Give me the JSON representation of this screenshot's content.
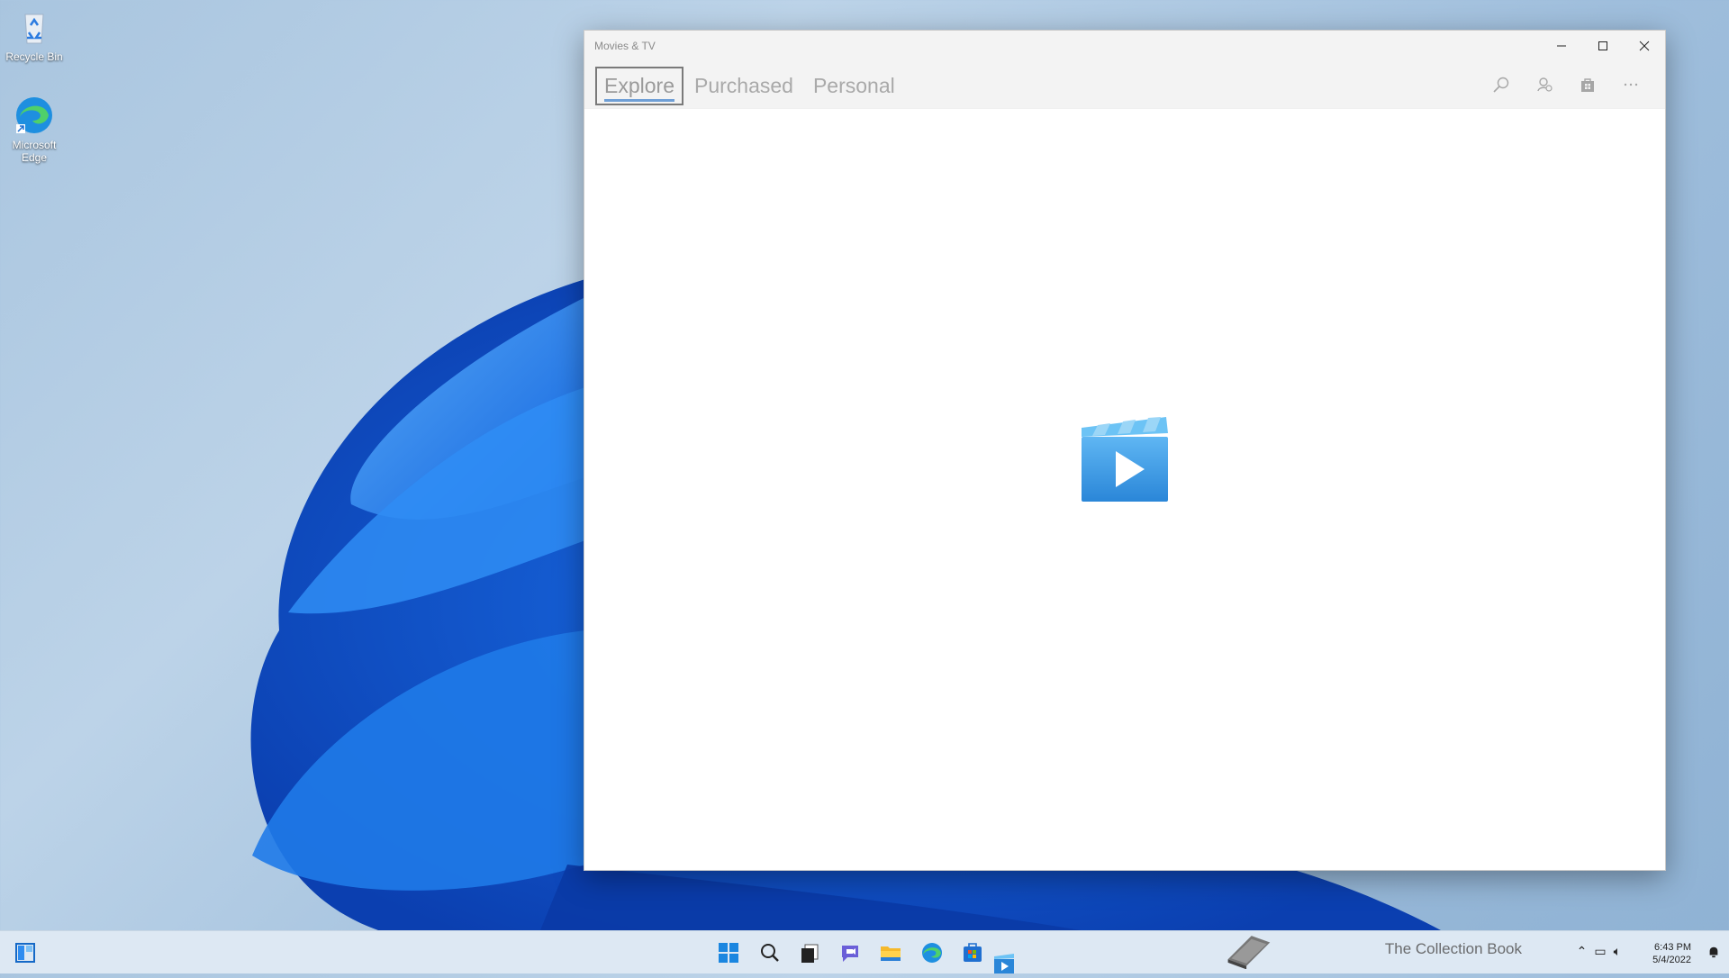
{
  "desktop": {
    "icons": [
      {
        "label": "Recycle Bin"
      },
      {
        "label": "Microsoft Edge"
      }
    ]
  },
  "window": {
    "title": "Movies & TV",
    "caption": {
      "minimize": "minimize-icon",
      "maximize": "maximize-icon",
      "close": "close-icon"
    },
    "tabs": [
      {
        "label": "Explore",
        "selected": true
      },
      {
        "label": "Purchased",
        "selected": false
      },
      {
        "label": "Personal",
        "selected": false
      }
    ],
    "tools": [
      "search-icon",
      "account-icon",
      "store-bag-icon",
      "more-icon"
    ],
    "accent": "#3a8ee6"
  },
  "taskbar": {
    "items": [
      "widgets-icon",
      "start-icon",
      "search-icon",
      "task-view-icon",
      "chat-icon",
      "file-explorer-icon",
      "edge-icon",
      "store-icon",
      "movies-tv-icon"
    ],
    "tray": {
      "watermark": "The Collection Book",
      "time": "6:43 PM",
      "date": "5/4/2022"
    }
  }
}
